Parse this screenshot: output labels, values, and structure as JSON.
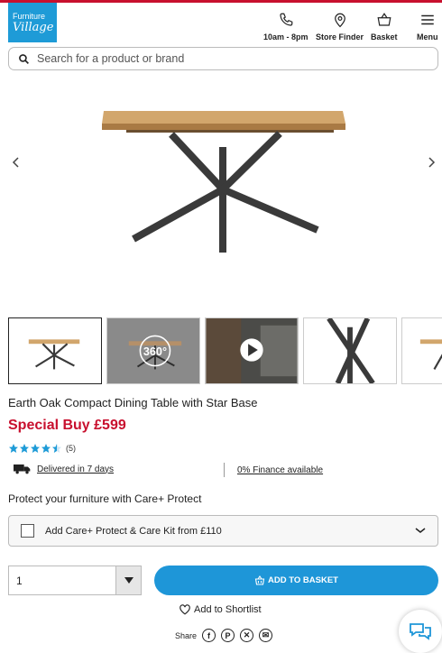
{
  "header": {
    "logo_line1": "Furniture",
    "logo_line2": "Village",
    "hours_label": "10am - 8pm",
    "store_finder_label": "Store Finder",
    "basket_label": "Basket",
    "menu_label": "Menu"
  },
  "search": {
    "placeholder": "Search for a product or brand"
  },
  "product": {
    "title": "Earth Oak Compact Dining Table with Star Base",
    "price": "Special Buy £599",
    "rating_stars": 4.5,
    "review_count": "(5)",
    "delivery_text": "Delivered in 7 days",
    "finance_text": "0% Finance available"
  },
  "gallery": {
    "spin_label": "360°"
  },
  "care_plus": {
    "section_title": "Protect your furniture with Care+ Protect",
    "option_label": "Add Care+ Protect & Care Kit from £110"
  },
  "purchase": {
    "quantity": "1",
    "add_to_basket_label": "ADD TO BASKET",
    "shortlist_label": "Add to Shortlist",
    "share_label": "Share"
  },
  "colors": {
    "brand_blue": "#1e96d8",
    "price_red": "#c8102e"
  }
}
